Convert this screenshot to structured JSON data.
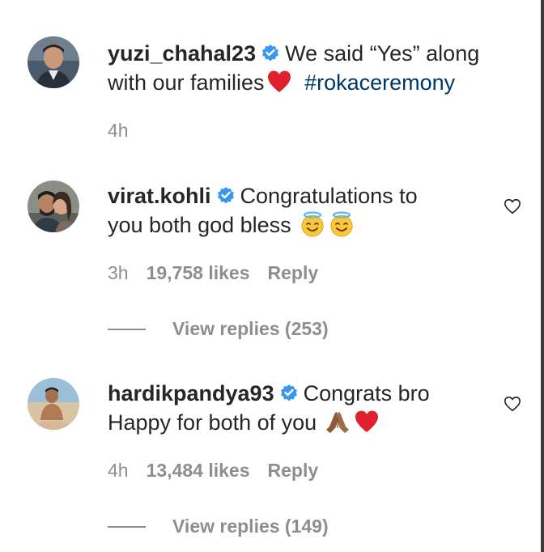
{
  "comments": [
    {
      "username": "yuzi_chahal23",
      "verified": true,
      "text_line1": "We said “Yes” along",
      "text_line2": "with our families",
      "hashtag": "#rokaceremony",
      "emojis": [
        "red-heart"
      ],
      "time": "4h"
    },
    {
      "username": "virat.kohli",
      "verified": true,
      "text_line1": "Congratulations to",
      "text_line2": "you both god bless",
      "emojis": [
        "smiling-face-with-halo",
        "smiling-face-with-halo"
      ],
      "time": "3h",
      "likes": "19,758 likes",
      "reply_label": "Reply",
      "view_replies": "View replies (253)"
    },
    {
      "username": "hardikpandya93",
      "verified": true,
      "text_line1": "Congrats bro",
      "text_line2": "Happy for both of you",
      "emojis": [
        "folded-hands",
        "red-heart"
      ],
      "time": "4h",
      "likes": "13,484 likes",
      "reply_label": "Reply",
      "view_replies": "View replies (149)"
    }
  ],
  "colors": {
    "text": "#262626",
    "secondary": "#8e8e8e",
    "hashtag": "#00376b",
    "verified": "#3897f0",
    "heart": "#e0245e"
  }
}
